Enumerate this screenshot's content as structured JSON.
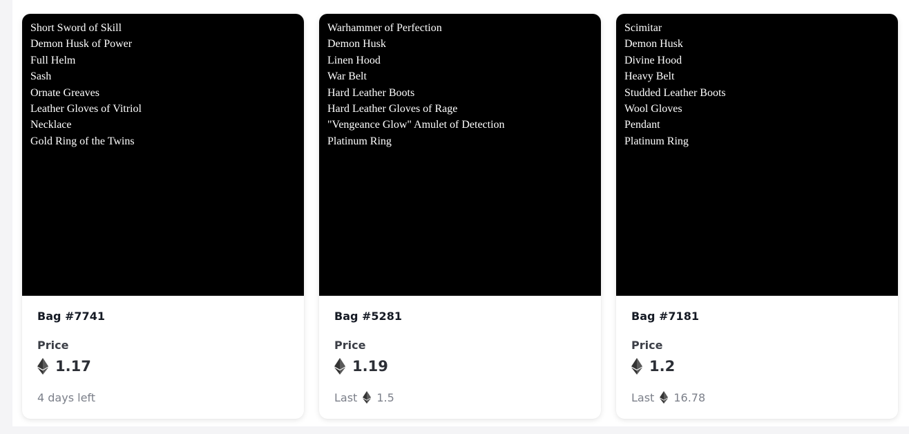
{
  "cards": [
    {
      "items": [
        "Short Sword of Skill",
        "Demon Husk of Power",
        "Full Helm",
        "Sash",
        "Ornate Greaves",
        "Leather Gloves of Vitriol",
        "Necklace",
        "Gold Ring of the Twins"
      ],
      "title": "Bag #7741",
      "price_label": "Price",
      "price": "1.17",
      "footer_text": "4 days left"
    },
    {
      "items": [
        "Warhammer of Perfection",
        "Demon Husk",
        "Linen Hood",
        "War Belt",
        "Hard Leather Boots",
        "Hard Leather Gloves of Rage",
        "\"Vengeance Glow\" Amulet of Detection",
        "Platinum Ring"
      ],
      "title": "Bag #5281",
      "price_label": "Price",
      "price": "1.19",
      "footer_label": "Last",
      "footer_value": "1.5"
    },
    {
      "items": [
        "Scimitar",
        "Demon Husk",
        "Divine Hood",
        "Heavy Belt",
        "Studded Leather Boots",
        "Wool Gloves",
        "Pendant",
        "Platinum Ring"
      ],
      "title": "Bag #7181",
      "price_label": "Price",
      "price": "1.2",
      "footer_label": "Last",
      "footer_value": "16.78"
    }
  ],
  "icons": {
    "currency": "ethereum-icon"
  },
  "colors": {
    "art_background": "#000000",
    "art_text": "#ffffff",
    "title": "#151a24",
    "muted": "#7b7f89"
  }
}
